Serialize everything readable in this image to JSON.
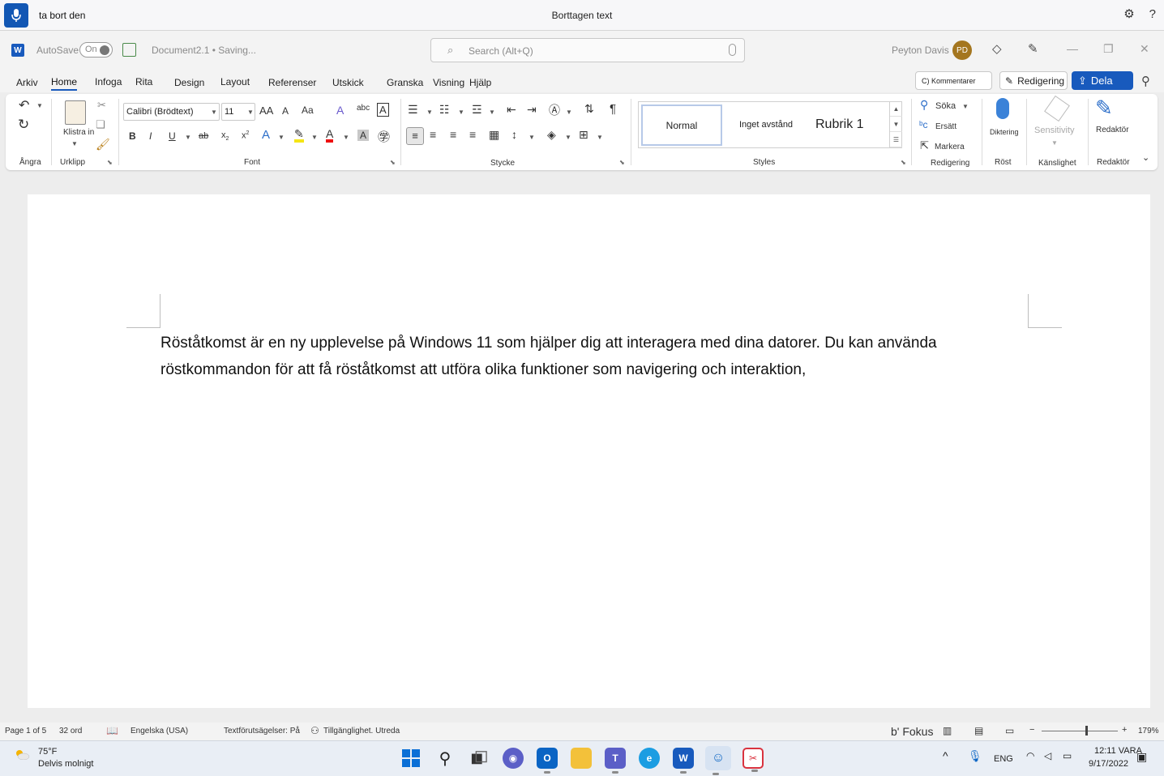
{
  "voice_access": {
    "recognized_text": "ta bort den",
    "status_message": "Borttagen text",
    "settings_icon": "gear-icon",
    "help_label": "?"
  },
  "titlebar": {
    "autosave_label": "AutoSave",
    "autosave_state": "On",
    "document_name": "Document2.1 • Saving...",
    "search_placeholder": "Search (Alt+Q)",
    "user_name": "Peyton Davis",
    "user_initials": "PD"
  },
  "tabs": {
    "items": [
      "Arkiv",
      "Home",
      "Infoga",
      "Rita",
      "Design",
      "Layout",
      "Referenser",
      "Utskick",
      "Granska",
      "Visning",
      "Hjälp"
    ],
    "active": "Home",
    "comments_label": "C) Kommentarer",
    "editing_label": "Redigering",
    "share_label": "Dela"
  },
  "ribbon": {
    "groups": {
      "undo": "Ångra",
      "clipboard": "Urklipp",
      "font": "Font",
      "paragraph": "Stycke",
      "styles": "Styles",
      "editing": "Redigering",
      "voice": "Röst",
      "sensitivity": "Känslighet",
      "editor": "Redaktör"
    },
    "paste_label": "Klistra in",
    "font_name": "Calibri (Brödtext)",
    "font_size": "11",
    "grow_font": "AA",
    "shrink_font": "A",
    "change_case": "Aa",
    "bold": "B",
    "italic": "I",
    "underline": "U",
    "strikethrough": "ab",
    "subscript": "x",
    "superscript": "x",
    "styles": [
      "Normal",
      "Inget avstånd",
      "Rubrik 1"
    ],
    "find_label": "Söka",
    "replace_label": "Ersätt",
    "select_label": "Markera",
    "dictate_label": "Diktering",
    "sensitivity_label": "Sensitivity",
    "editor_label": "Redaktör"
  },
  "document": {
    "paragraph": "Röståtkomst är en ny upplevelse på Windows 11 som hjälper dig att interagera med dina datorer. Du kan använda röstkommandon för att få röståtkomst att utföra olika funktioner som navigering och interaktion,"
  },
  "statusbar": {
    "page": "Page 1 of 5",
    "words": "32 ord",
    "language": "Engelska (USA)",
    "text_predictions": "Textförutsägelser: På",
    "accessibility": "Tillgänglighet. Utreda",
    "focus": "b' Fokus",
    "zoom": "179%",
    "zoom_level": 0.58
  },
  "taskbar": {
    "temperature": "75°F",
    "weather": "Delvis molnigt",
    "language": "ENG",
    "time": "12:11 VARA",
    "date": "9/17/2022",
    "apps": [
      "start-icon",
      "search-icon",
      "task-view-icon",
      "chat-icon",
      "outlook-icon",
      "file-explorer-icon",
      "teams-icon",
      "edge-icon",
      "word-icon",
      "voice-access-icon",
      "snipping-tool-icon"
    ]
  }
}
